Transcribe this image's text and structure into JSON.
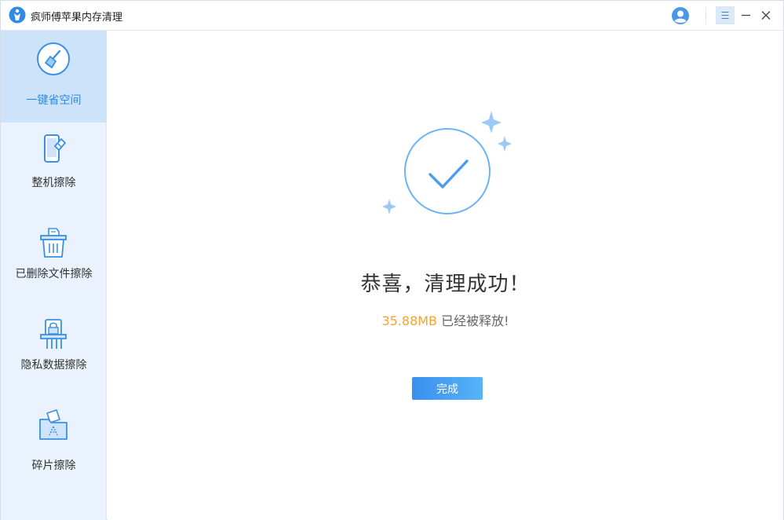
{
  "app": {
    "title": "疯师傅苹果内存清理"
  },
  "titlebar": {
    "icons": [
      "app-logo-icon",
      "user-icon",
      "menu-icon",
      "minimize-icon",
      "close-icon"
    ]
  },
  "sidebar": {
    "items": [
      {
        "label": "一键省空间",
        "icon": "broom-icon",
        "active": true
      },
      {
        "label": "整机擦除",
        "icon": "phone-eraser-icon",
        "active": false
      },
      {
        "label": "已删除文件擦除",
        "icon": "trash-icon",
        "active": false
      },
      {
        "label": "隐私数据擦除",
        "icon": "lock-shredder-icon",
        "active": false
      },
      {
        "label": "碎片擦除",
        "icon": "folder-fragment-icon",
        "active": false
      }
    ]
  },
  "main": {
    "headline": "恭喜，清理成功！",
    "freed_size": "35.88MB",
    "freed_suffix": " 已经被释放!",
    "done_label": "完成"
  },
  "colors": {
    "accent": "#2d8ae8",
    "sidebar_bg": "#eaf3fd",
    "sidebar_active": "#cde3fa",
    "highlight": "#f5a234"
  }
}
